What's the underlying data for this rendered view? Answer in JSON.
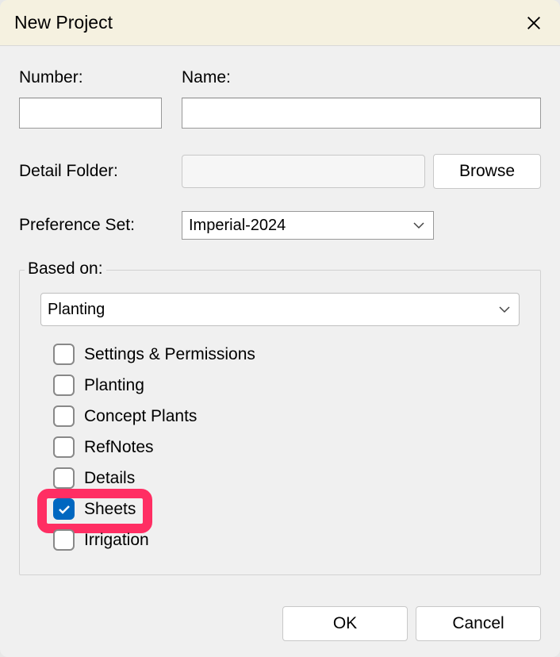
{
  "titlebar": {
    "title": "New Project"
  },
  "fields": {
    "number_label": "Number:",
    "number_value": "",
    "name_label": "Name:",
    "name_value": "",
    "detail_folder_label": "Detail Folder:",
    "detail_folder_value": "",
    "browse_label": "Browse",
    "pref_set_label": "Preference Set:",
    "pref_set_value": "Imperial-2024"
  },
  "based_on": {
    "legend": "Based on:",
    "template_value": "Planting",
    "items": [
      {
        "label": "Settings & Permissions",
        "checked": false
      },
      {
        "label": "Planting",
        "checked": false
      },
      {
        "label": "Concept Plants",
        "checked": false
      },
      {
        "label": "RefNotes",
        "checked": false
      },
      {
        "label": "Details",
        "checked": false
      },
      {
        "label": "Sheets",
        "checked": true,
        "highlighted": true
      },
      {
        "label": "Irrigation",
        "checked": false
      }
    ]
  },
  "footer": {
    "ok_label": "OK",
    "cancel_label": "Cancel"
  }
}
